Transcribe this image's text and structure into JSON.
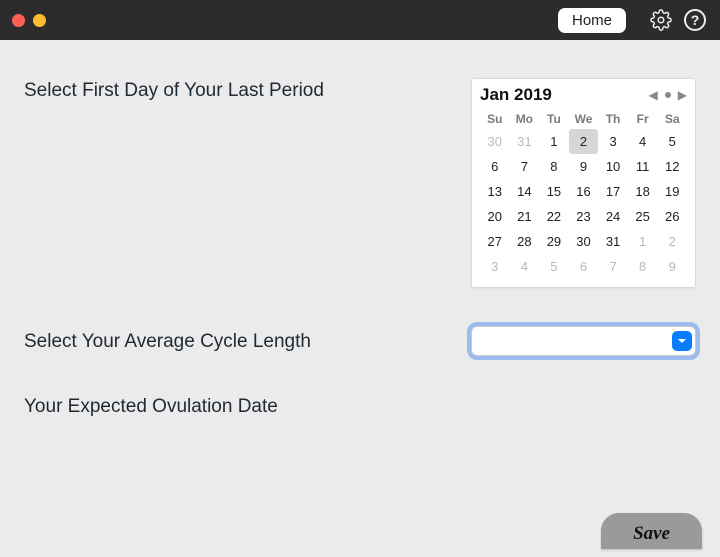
{
  "titlebar": {
    "home_label": "Home"
  },
  "labels": {
    "select_first_day": "Select First Day of Your Last Period",
    "avg_cycle": "Select Your Average Cycle Length",
    "expected_ovulation": "Your Expected Ovulation Date"
  },
  "calendar": {
    "month": "Jan",
    "year": "2019",
    "dow": [
      "Su",
      "Mo",
      "Tu",
      "We",
      "Th",
      "Fr",
      "Sa"
    ],
    "selected_day": 2,
    "weeks": [
      [
        {
          "d": 30,
          "o": true
        },
        {
          "d": 31,
          "o": true
        },
        {
          "d": 1
        },
        {
          "d": 2,
          "sel": true
        },
        {
          "d": 3
        },
        {
          "d": 4
        },
        {
          "d": 5
        }
      ],
      [
        {
          "d": 6
        },
        {
          "d": 7
        },
        {
          "d": 8
        },
        {
          "d": 9
        },
        {
          "d": 10
        },
        {
          "d": 11
        },
        {
          "d": 12
        }
      ],
      [
        {
          "d": 13
        },
        {
          "d": 14
        },
        {
          "d": 15
        },
        {
          "d": 16
        },
        {
          "d": 17
        },
        {
          "d": 18
        },
        {
          "d": 19
        }
      ],
      [
        {
          "d": 20
        },
        {
          "d": 21
        },
        {
          "d": 22
        },
        {
          "d": 23
        },
        {
          "d": 24
        },
        {
          "d": 25
        },
        {
          "d": 26
        }
      ],
      [
        {
          "d": 27
        },
        {
          "d": 28
        },
        {
          "d": 29
        },
        {
          "d": 30
        },
        {
          "d": 31
        },
        {
          "d": 1,
          "o": true
        },
        {
          "d": 2,
          "o": true
        }
      ],
      [
        {
          "d": 3,
          "o": true
        },
        {
          "d": 4,
          "o": true
        },
        {
          "d": 5,
          "o": true
        },
        {
          "d": 6,
          "o": true
        },
        {
          "d": 7,
          "o": true
        },
        {
          "d": 8,
          "o": true
        },
        {
          "d": 9,
          "o": true
        }
      ]
    ]
  },
  "cycle_length": {
    "value": ""
  },
  "expected_ovulation_value": "",
  "buttons": {
    "save": "Save"
  }
}
